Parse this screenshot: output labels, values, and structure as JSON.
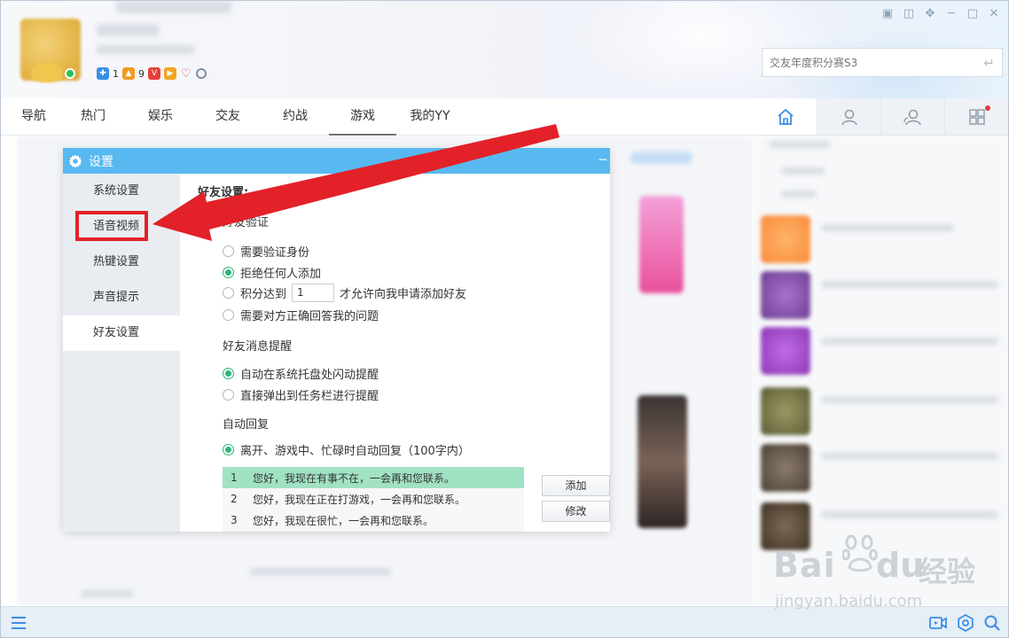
{
  "window": {
    "controls": [
      "skin-icon",
      "mini-icon",
      "pin-icon",
      "minimize-icon",
      "maximize-icon",
      "close-icon"
    ]
  },
  "profile": {
    "badges": [
      {
        "icon": "game-controller-icon",
        "count": "1"
      },
      {
        "icon": "fire-icon",
        "count": "9"
      },
      {
        "icon": "vip-icon",
        "count": ""
      },
      {
        "icon": "play-icon",
        "count": ""
      },
      {
        "icon": "heart-icon",
        "count": ""
      },
      {
        "icon": "ring-icon",
        "count": ""
      }
    ]
  },
  "search": {
    "placeholder": "交友年度积分赛S3"
  },
  "nav": {
    "tabs": [
      "导航",
      "热门",
      "娱乐",
      "交友",
      "约战",
      "游戏",
      "我的YY"
    ],
    "active": "游戏"
  },
  "right_tabs": [
    {
      "icon": "home-icon",
      "active": true
    },
    {
      "icon": "person-icon",
      "active": false
    },
    {
      "icon": "group-icon",
      "active": false
    },
    {
      "icon": "apps-icon",
      "active": false
    }
  ],
  "dialog": {
    "title": "设置",
    "menu": [
      {
        "label": "系统设置",
        "active": false
      },
      {
        "label": "语音视频",
        "active": false
      },
      {
        "label": "热键设置",
        "active": false
      },
      {
        "label": "声音提示",
        "active": false
      },
      {
        "label": "好友设置",
        "active": true
      }
    ],
    "panel_title": "好友设置:",
    "verify": {
      "title": "好友验证",
      "options": [
        {
          "label": "需要验证身份",
          "checked": false
        },
        {
          "label": "拒绝任何人添加",
          "checked": true
        },
        {
          "label": "积分达到",
          "checked": false,
          "input_value": "1",
          "suffix": "才允许向我申请添加好友"
        },
        {
          "label": "需要对方正确回答我的问题",
          "checked": false
        }
      ]
    },
    "reminder": {
      "title": "好友消息提醒",
      "options": [
        {
          "label": "自动在系统托盘处闪动提醒",
          "checked": true
        },
        {
          "label": "直接弹出到任务栏进行提醒",
          "checked": false
        }
      ]
    },
    "auto_reply": {
      "title": "自动回复",
      "option": {
        "label": "离开、游戏中、忙碌时自动回复（100字内）",
        "checked": true
      },
      "rows": [
        {
          "index": "1",
          "text": "您好，我现在有事不在，一会再和您联系。",
          "selected": true
        },
        {
          "index": "2",
          "text": "您好，我现在正在打游戏，一会再和您联系。",
          "selected": false
        },
        {
          "index": "3",
          "text": "您好，我现在很忙，一会再和您联系。",
          "selected": false
        }
      ],
      "buttons": {
        "add": "添加",
        "edit": "修改"
      }
    }
  },
  "annotation": {
    "color": "#e32129",
    "target": "语音视频"
  },
  "watermark": {
    "brand": "Bai",
    "brand2": "du",
    "cn": "经验",
    "url": "jingyan.baidu.com"
  },
  "colors": {
    "accent": "#58b9f0",
    "radio_on": "#2fb57a",
    "selected_row": "#a2e2c4"
  }
}
